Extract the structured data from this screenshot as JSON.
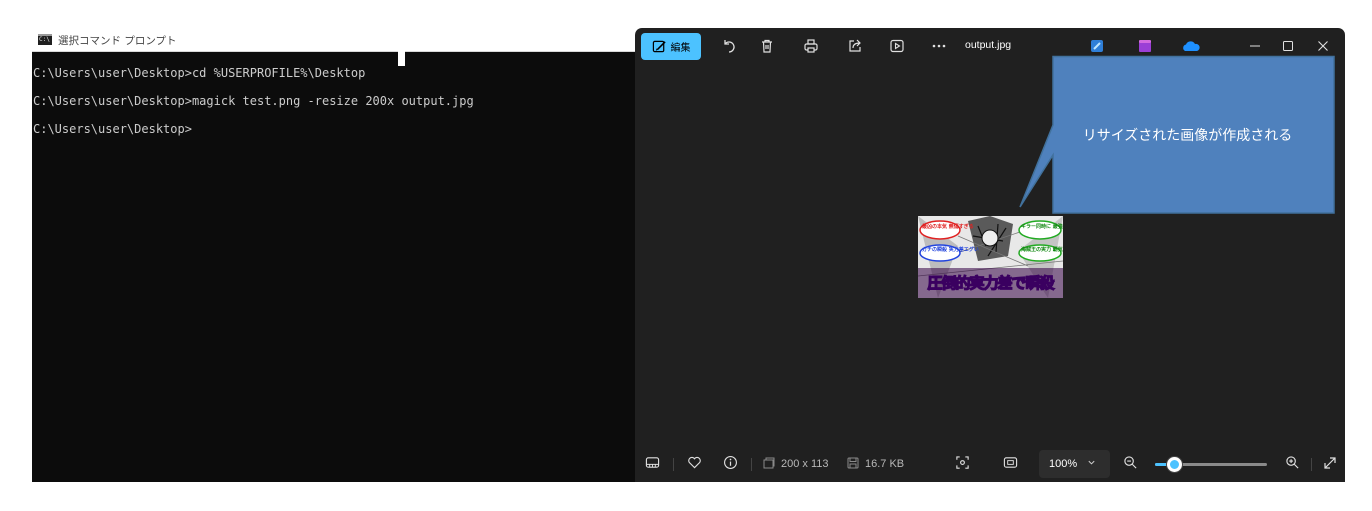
{
  "cmd": {
    "title": "選択コマンド プロンプト",
    "icon_text": "C:\\",
    "lines": [
      "C:\\Users\\user\\Desktop>cd %USERPROFILE%\\Desktop",
      "C:\\Users\\user\\Desktop>magick test.png -resize 200x output.jpg",
      "C:\\Users\\user\\Desktop>"
    ]
  },
  "viewer": {
    "edit_label": "編集",
    "filename": "output.jpg",
    "toolbar_icons": [
      "rotate-icon",
      "delete-icon",
      "print-icon",
      "share-icon",
      "slideshow-icon",
      "more-icon"
    ],
    "account_icons": [
      "clipchamp-icon",
      "designer-icon",
      "onedrive-icon"
    ],
    "window_controls": [
      "minimize-icon",
      "maximize-icon",
      "close-icon"
    ],
    "image": {
      "caption": "圧倒的実力差で瞬殺",
      "bubbles": [
        "最凶の本気 無傷すぎる",
        "キラー同時に 最強は衝撃",
        "ガチの瞬殺 実力差エグい",
        "海賊王の実力 覇気ヤバイ"
      ]
    },
    "callout": "リサイズされた画像が作成される",
    "status": {
      "dimensions": "200 x 113",
      "file_size": "16.7 KB",
      "zoom": "100%",
      "zoom_level": 0.17
    },
    "colors": {
      "accent": "#4cc2ff",
      "callout_fill": "#4f81bd",
      "callout_border": "#41719c",
      "background": "#202020",
      "terminal": "#0c0c0c"
    }
  }
}
